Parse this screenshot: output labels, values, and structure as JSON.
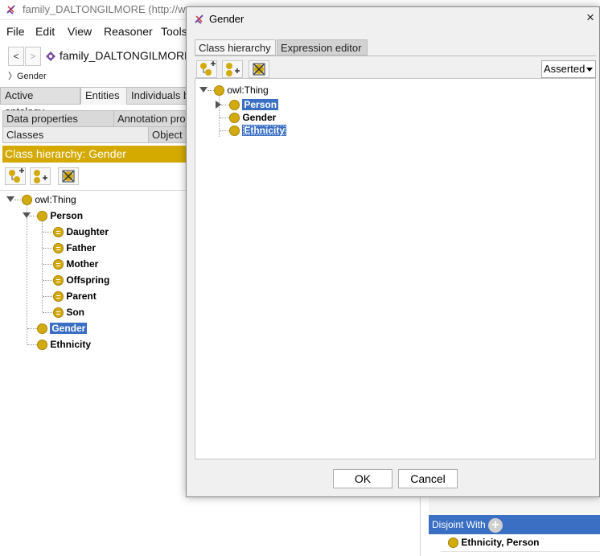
{
  "main_window": {
    "title": "family_DALTONGILMORE (http://www...",
    "menu": [
      "File",
      "Edit",
      "View",
      "Reasoner",
      "Tools"
    ],
    "nav": {
      "back": "<",
      "forward": ">",
      "ontology": "family_DALTONGILMORE"
    },
    "breadcrumb": "Gender",
    "tabs": [
      "Active ontology",
      "Entities",
      "Individuals b"
    ],
    "subtabs_row1": [
      "Data properties",
      "Annotation pro"
    ],
    "subtabs_row2": [
      "Classes",
      "Object"
    ],
    "class_hierarchy_title": "Class hierarchy: Gender",
    "tree": {
      "root": "owl:Thing",
      "person": "Person",
      "children": [
        "Daughter",
        "Father",
        "Mother",
        "Offspring",
        "Parent",
        "Son"
      ],
      "gender": "Gender",
      "ethnicity": "Ethnicity"
    },
    "disjoint": {
      "label": "Disjoint With",
      "value": "Ethnicity, Person"
    }
  },
  "dialog": {
    "title": "Gender",
    "close": "×",
    "tabs": [
      "Class hierarchy",
      "Expression editor"
    ],
    "dropdown": "Asserted",
    "tree": {
      "root": "owl:Thing",
      "items": [
        "Person",
        "Gender",
        "Ethnicity"
      ]
    },
    "ok": "OK",
    "cancel": "Cancel"
  },
  "colors": {
    "class_gold": "#d2ab10",
    "selection_blue": "#3a6fc4",
    "header_gold": "#d4aa00"
  }
}
